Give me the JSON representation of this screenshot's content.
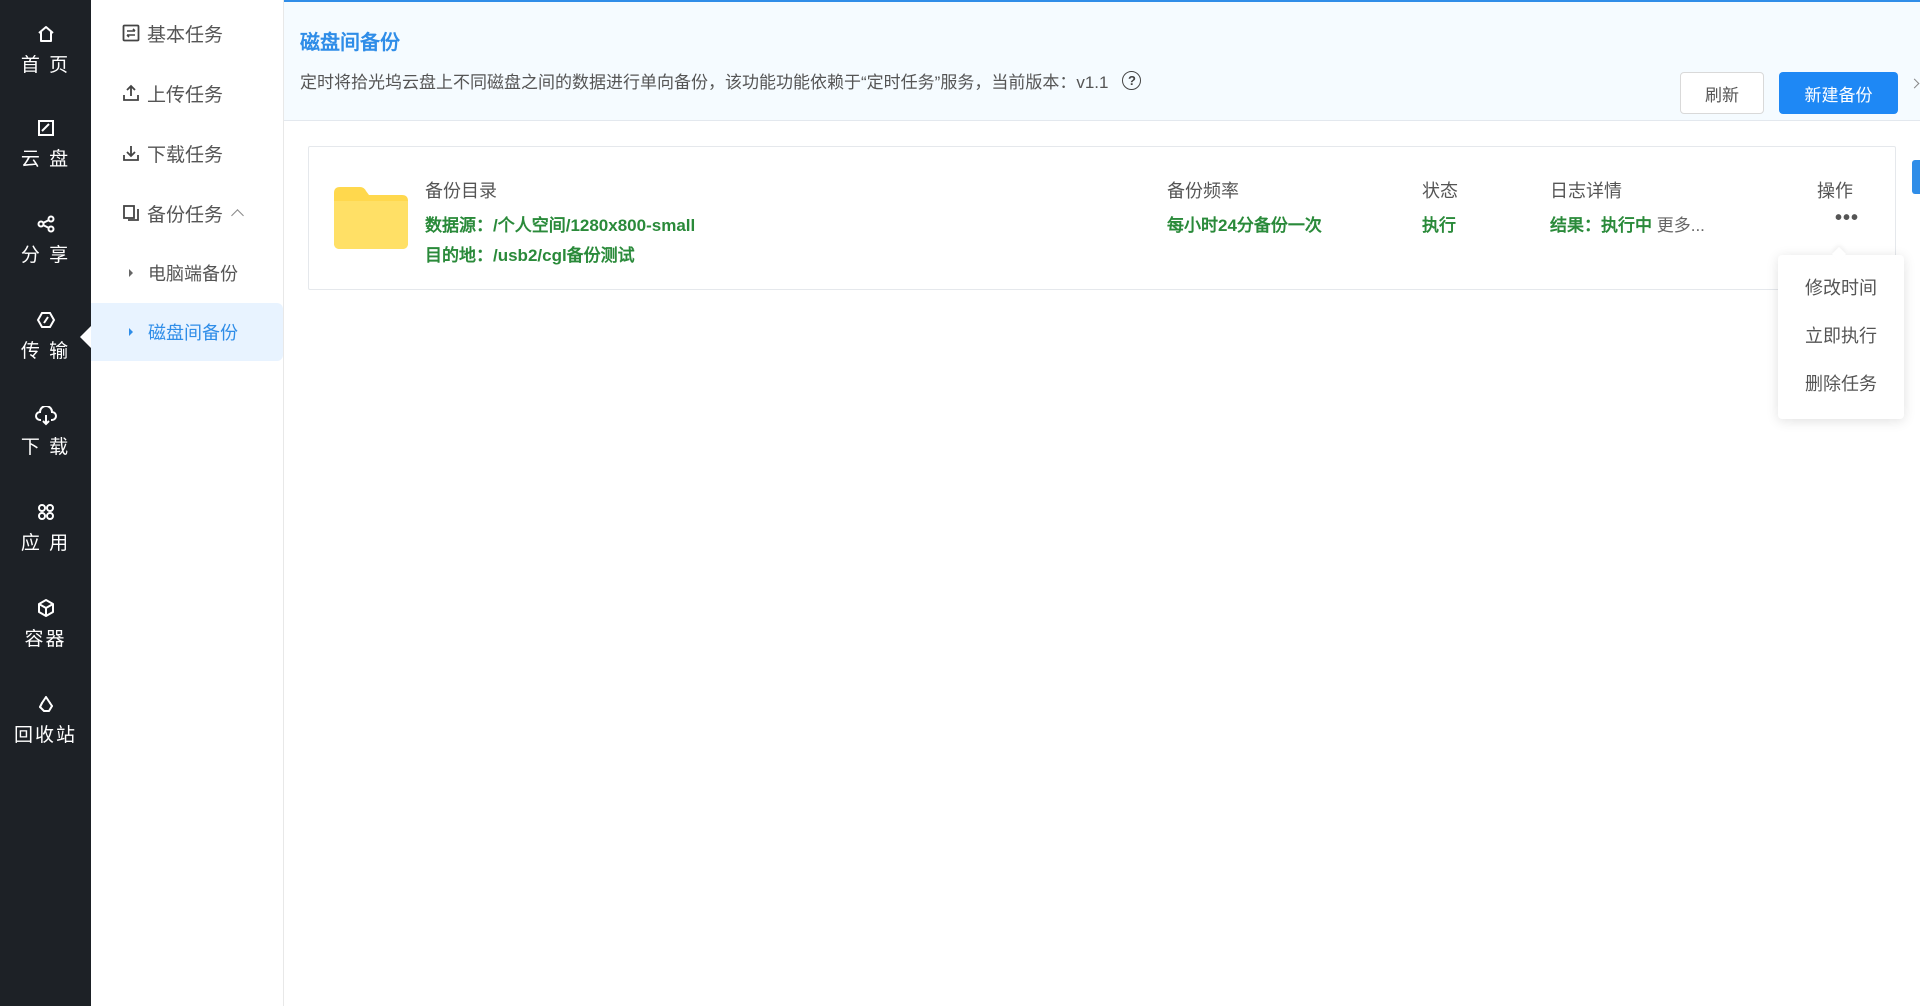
{
  "nav": {
    "items": [
      {
        "label": "首 页",
        "icon": "home-icon"
      },
      {
        "label": "云 盘",
        "icon": "cloud-disk-icon"
      },
      {
        "label": "分 享",
        "icon": "share-icon"
      },
      {
        "label": "传 输",
        "icon": "transfer-icon"
      },
      {
        "label": "下 载",
        "icon": "download-cloud-icon"
      },
      {
        "label": "应 用",
        "icon": "apps-icon"
      },
      {
        "label": "容器",
        "icon": "container-icon"
      },
      {
        "label": "回收站",
        "icon": "recycle-icon"
      }
    ],
    "active_index": 3
  },
  "submenu": {
    "basic_tasks": "基本任务",
    "upload_tasks": "上传任务",
    "download_tasks": "下载任务",
    "backup_tasks": "备份任务",
    "pc_backup": "电脑端备份",
    "disk_backup": "磁盘间备份"
  },
  "header": {
    "title": "磁盘间备份",
    "description": "定时将拾光坞云盘上不同磁盘之间的数据进行单向备份，该功能功能依赖于“定时任务”服务，当前版本：v1.1",
    "help": "?",
    "refresh_label": "刷新",
    "new_backup_label": "新建备份"
  },
  "table": {
    "headers": {
      "dir": "备份目录",
      "freq": "备份频率",
      "status": "状态",
      "log": "日志详情",
      "ops": "操作"
    },
    "row": {
      "source": "数据源：/个人空间/1280x800-small",
      "dest": "目的地：/usb2/cgl备份测试",
      "frequency": "每小时24分备份一次",
      "status": "执行",
      "result": "结果：执行中",
      "more": "更多...",
      "ops_icon": "•••"
    }
  },
  "dropdown": {
    "items": [
      "修改时间",
      "立即执行",
      "删除任务"
    ]
  },
  "colors": {
    "accent": "#2f8de8",
    "nav_bg": "#1d2126",
    "green": "#2a8a3a",
    "folder": "#ffd84d"
  }
}
